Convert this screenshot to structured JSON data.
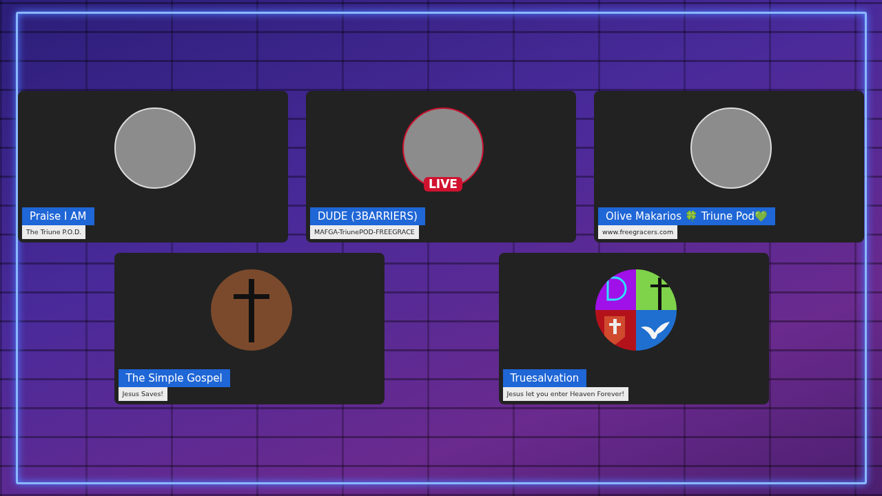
{
  "tiles": [
    {
      "name": "Praise I AM",
      "subtitle": "The Triune P.O.D.",
      "avatar": {
        "kind": "photo"
      }
    },
    {
      "name": "DUDE (3BARRIERS)",
      "subtitle": "MAFGA-TriunePOD-FREEGRACE",
      "avatar": {
        "kind": "photo",
        "badge": "LIVE"
      }
    },
    {
      "name": "Olive Makarios 🍀 Triune Pod💚",
      "subtitle": "www.freegracers.com",
      "avatar": {
        "kind": "photo"
      }
    },
    {
      "name": "The Simple Gospel",
      "subtitle": "Jesus Saves!",
      "avatar": {
        "kind": "cross"
      }
    },
    {
      "name": "Truesalvation",
      "subtitle": "Jesus let you enter Heaven Forever!",
      "avatar": {
        "kind": "quadrants"
      }
    }
  ]
}
